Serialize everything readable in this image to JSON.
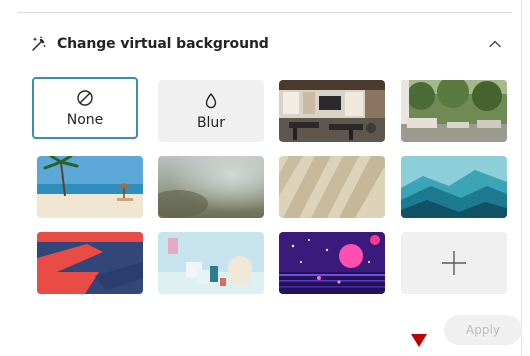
{
  "panel": {
    "title": "Change virtual background",
    "apply_label": "Apply"
  },
  "icons": {
    "header": "magic-wand-icon",
    "collapse": "chevron-up-icon",
    "none": "circle-slash-icon",
    "blur": "drop-icon",
    "add": "plus-icon"
  },
  "tiles": [
    {
      "id": "none",
      "label": "None",
      "kind": "option",
      "selected": true
    },
    {
      "id": "blur",
      "label": "Blur",
      "kind": "option",
      "selected": false
    },
    {
      "id": "office-loft",
      "kind": "image",
      "selected": false
    },
    {
      "id": "forest-room",
      "kind": "image",
      "selected": false
    },
    {
      "id": "beach",
      "kind": "image",
      "selected": false
    },
    {
      "id": "blurred-landscape",
      "kind": "image",
      "selected": false
    },
    {
      "id": "shadow-wall",
      "kind": "image",
      "selected": false
    },
    {
      "id": "teal-mountains",
      "kind": "image",
      "selected": false
    },
    {
      "id": "red-stripe",
      "kind": "image",
      "selected": false
    },
    {
      "id": "pastel-room",
      "kind": "image",
      "selected": false
    },
    {
      "id": "neon-space",
      "kind": "image",
      "selected": false
    },
    {
      "id": "add-background",
      "kind": "add",
      "selected": false
    }
  ],
  "colors": {
    "selected_border": "#3a8fb0",
    "tile_bg": "#f0f0f0",
    "apply_text_disabled": "#bdbdbd",
    "pointer_marker": "#c00000"
  }
}
